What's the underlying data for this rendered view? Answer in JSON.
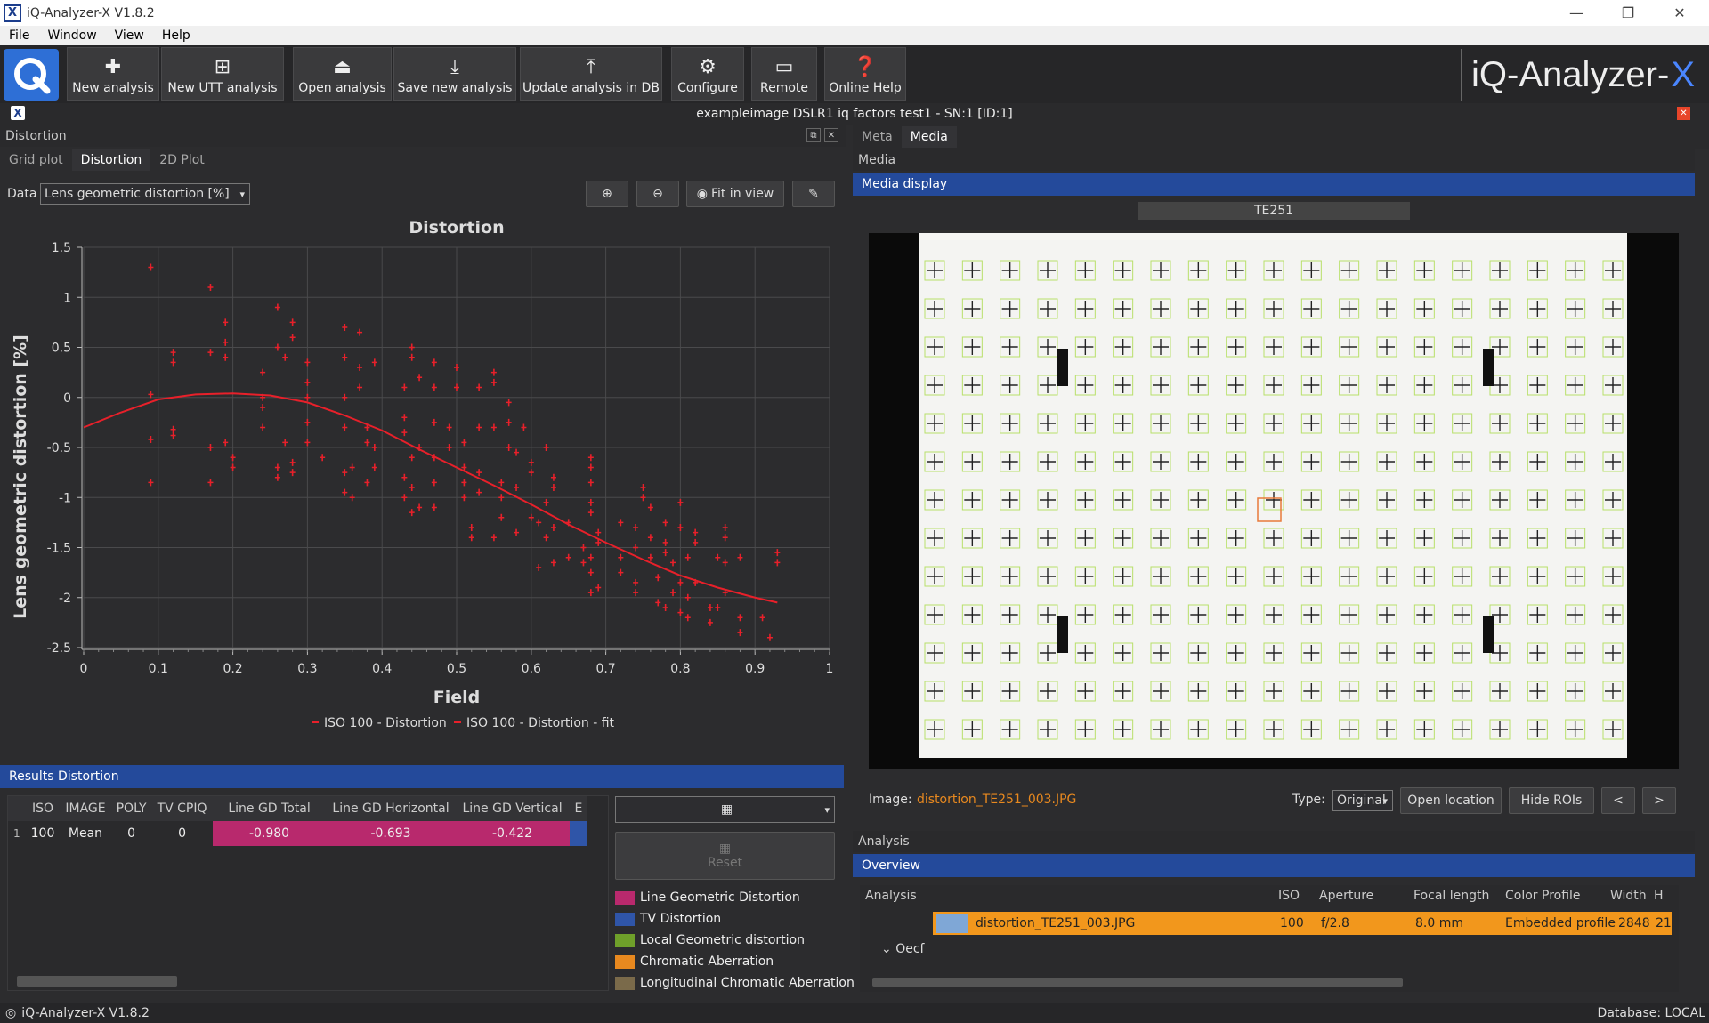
{
  "window": {
    "title": "iQ-Analyzer-X V1.8.2",
    "minimize_glyph": "—",
    "restore_glyph": "❐",
    "close_glyph": "✕"
  },
  "menu": [
    "File",
    "Window",
    "View",
    "Help"
  ],
  "toolbar": {
    "buttons": [
      {
        "label": "New analysis",
        "icon": "plus-icon"
      },
      {
        "label": "New UTT analysis",
        "icon": "utt-icon"
      },
      {
        "label": "Open analysis",
        "icon": "open-icon"
      },
      {
        "label": "Save new analysis",
        "icon": "save-icon"
      },
      {
        "label": "Update analysis in DB",
        "icon": "db-icon"
      },
      {
        "label": "Configure",
        "icon": "gear-icon"
      },
      {
        "label": "Remote",
        "icon": "monitor-icon"
      },
      {
        "label": "Online Help",
        "icon": "help-icon"
      }
    ],
    "brand": "iQ-Analyzer-",
    "brand_accent": "X"
  },
  "document": {
    "title": "exampleimage DSLR1 iq factors test1 - SN:1 [ID:1]"
  },
  "left_panel": {
    "title": "Distortion",
    "tabs": [
      "Grid plot",
      "Distortion",
      "2D Plot"
    ],
    "active_tab": "Distortion",
    "data_label": "Data",
    "data_select": "Lens geometric distortion [%]",
    "fit_button": "Fit in view"
  },
  "chart_data": {
    "type": "scatter",
    "title": "Distortion",
    "xlabel": "Field",
    "ylabel": "Lens geometric distortion [%]",
    "xlim": [
      0,
      1
    ],
    "ylim": [
      -2.5,
      1.5
    ],
    "xticks": [
      "0",
      "0.1",
      "0.2",
      "0.3",
      "0.4",
      "0.5",
      "0.6",
      "0.7",
      "0.8",
      "0.9",
      "1"
    ],
    "yticks": [
      "1.5",
      "1",
      "0.5",
      "0",
      "-0.5",
      "-1",
      "-1.5",
      "-2",
      "-2.5"
    ],
    "grid": true,
    "legend_placement": "bottom",
    "color": "#e8202a",
    "series": [
      {
        "name": "ISO 100 - Distortion",
        "kind": "scatter",
        "points": [
          [
            0.09,
            1.3
          ],
          [
            0.09,
            0.03
          ],
          [
            0.09,
            -0.42
          ],
          [
            0.09,
            -0.85
          ],
          [
            0.12,
            0.45
          ],
          [
            0.12,
            0.35
          ],
          [
            0.12,
            -0.38
          ],
          [
            0.12,
            -0.32
          ],
          [
            0.17,
            1.1
          ],
          [
            0.17,
            0.45
          ],
          [
            0.17,
            -0.5
          ],
          [
            0.17,
            -0.85
          ],
          [
            0.19,
            0.75
          ],
          [
            0.19,
            0.55
          ],
          [
            0.19,
            0.4
          ],
          [
            0.19,
            -0.45
          ],
          [
            0.2,
            -0.6
          ],
          [
            0.2,
            -0.7
          ],
          [
            0.24,
            0.25
          ],
          [
            0.24,
            0.0
          ],
          [
            0.24,
            -0.1
          ],
          [
            0.24,
            -0.3
          ],
          [
            0.26,
            0.9
          ],
          [
            0.26,
            0.5
          ],
          [
            0.26,
            -0.7
          ],
          [
            0.26,
            -0.8
          ],
          [
            0.27,
            0.4
          ],
          [
            0.27,
            -0.45
          ],
          [
            0.28,
            0.75
          ],
          [
            0.28,
            0.6
          ],
          [
            0.28,
            -0.65
          ],
          [
            0.28,
            -0.75
          ],
          [
            0.3,
            0.35
          ],
          [
            0.3,
            0.15
          ],
          [
            0.3,
            0.0
          ],
          [
            0.3,
            -0.25
          ],
          [
            0.3,
            -0.45
          ],
          [
            0.32,
            -0.6
          ],
          [
            0.35,
            0.7
          ],
          [
            0.35,
            0.4
          ],
          [
            0.35,
            0.0
          ],
          [
            0.35,
            -0.3
          ],
          [
            0.35,
            -0.75
          ],
          [
            0.35,
            -0.95
          ],
          [
            0.36,
            -0.7
          ],
          [
            0.36,
            -1.0
          ],
          [
            0.37,
            0.65
          ],
          [
            0.37,
            0.3
          ],
          [
            0.37,
            0.1
          ],
          [
            0.38,
            -0.3
          ],
          [
            0.38,
            -0.45
          ],
          [
            0.38,
            -0.85
          ],
          [
            0.39,
            0.35
          ],
          [
            0.39,
            -0.5
          ],
          [
            0.39,
            -0.7
          ],
          [
            0.43,
            0.1
          ],
          [
            0.43,
            -0.2
          ],
          [
            0.43,
            -0.35
          ],
          [
            0.43,
            -0.8
          ],
          [
            0.43,
            -1.0
          ],
          [
            0.44,
            0.5
          ],
          [
            0.44,
            0.4
          ],
          [
            0.44,
            -0.6
          ],
          [
            0.44,
            -0.9
          ],
          [
            0.44,
            -1.15
          ],
          [
            0.45,
            0.2
          ],
          [
            0.45,
            -0.5
          ],
          [
            0.45,
            -1.1
          ],
          [
            0.47,
            0.35
          ],
          [
            0.47,
            0.1
          ],
          [
            0.47,
            -0.25
          ],
          [
            0.47,
            -0.6
          ],
          [
            0.47,
            -0.85
          ],
          [
            0.47,
            -1.1
          ],
          [
            0.49,
            -0.3
          ],
          [
            0.49,
            -0.5
          ],
          [
            0.5,
            0.3
          ],
          [
            0.5,
            0.1
          ],
          [
            0.51,
            -0.45
          ],
          [
            0.51,
            -0.7
          ],
          [
            0.51,
            -0.85
          ],
          [
            0.51,
            -1.0
          ],
          [
            0.52,
            -1.4
          ],
          [
            0.52,
            -1.3
          ],
          [
            0.53,
            0.1
          ],
          [
            0.53,
            -0.3
          ],
          [
            0.53,
            -0.75
          ],
          [
            0.53,
            -0.95
          ],
          [
            0.55,
            0.25
          ],
          [
            0.55,
            0.15
          ],
          [
            0.55,
            -0.3
          ],
          [
            0.55,
            -1.4
          ],
          [
            0.56,
            -0.85
          ],
          [
            0.56,
            -1.0
          ],
          [
            0.56,
            -1.2
          ],
          [
            0.57,
            -0.05
          ],
          [
            0.57,
            -0.25
          ],
          [
            0.57,
            -0.5
          ],
          [
            0.58,
            -0.55
          ],
          [
            0.58,
            -0.9
          ],
          [
            0.58,
            -1.35
          ],
          [
            0.59,
            -0.3
          ],
          [
            0.6,
            -0.65
          ],
          [
            0.6,
            -0.75
          ],
          [
            0.6,
            -1.2
          ],
          [
            0.61,
            -1.25
          ],
          [
            0.61,
            -1.7
          ],
          [
            0.62,
            -0.5
          ],
          [
            0.62,
            -1.05
          ],
          [
            0.62,
            -1.4
          ],
          [
            0.63,
            -0.8
          ],
          [
            0.63,
            -0.9
          ],
          [
            0.63,
            -1.3
          ],
          [
            0.63,
            -1.65
          ],
          [
            0.65,
            -1.25
          ],
          [
            0.65,
            -1.6
          ],
          [
            0.67,
            -1.5
          ],
          [
            0.67,
            -1.65
          ],
          [
            0.68,
            -0.6
          ],
          [
            0.68,
            -0.7
          ],
          [
            0.68,
            -0.85
          ],
          [
            0.68,
            -1.05
          ],
          [
            0.68,
            -1.15
          ],
          [
            0.68,
            -1.6
          ],
          [
            0.68,
            -1.75
          ],
          [
            0.68,
            -1.95
          ],
          [
            0.69,
            -1.35
          ],
          [
            0.69,
            -1.45
          ],
          [
            0.69,
            -1.9
          ],
          [
            0.72,
            -1.25
          ],
          [
            0.72,
            -1.6
          ],
          [
            0.72,
            -1.75
          ],
          [
            0.74,
            -1.3
          ],
          [
            0.74,
            -1.5
          ],
          [
            0.74,
            -1.85
          ],
          [
            0.74,
            -1.95
          ],
          [
            0.75,
            -0.9
          ],
          [
            0.75,
            -1.0
          ],
          [
            0.76,
            -1.1
          ],
          [
            0.76,
            -1.4
          ],
          [
            0.76,
            -1.6
          ],
          [
            0.77,
            -1.8
          ],
          [
            0.77,
            -2.05
          ],
          [
            0.78,
            -1.25
          ],
          [
            0.78,
            -1.45
          ],
          [
            0.78,
            -1.55
          ],
          [
            0.78,
            -2.1
          ],
          [
            0.79,
            -1.65
          ],
          [
            0.79,
            -1.95
          ],
          [
            0.8,
            -1.05
          ],
          [
            0.8,
            -1.3
          ],
          [
            0.8,
            -1.85
          ],
          [
            0.8,
            -2.15
          ],
          [
            0.81,
            -2.0
          ],
          [
            0.81,
            -2.2
          ],
          [
            0.81,
            -1.6
          ],
          [
            0.82,
            -1.35
          ],
          [
            0.82,
            -1.45
          ],
          [
            0.82,
            -1.85
          ],
          [
            0.84,
            -2.1
          ],
          [
            0.84,
            -2.25
          ],
          [
            0.85,
            -1.6
          ],
          [
            0.85,
            -2.1
          ],
          [
            0.86,
            -1.3
          ],
          [
            0.86,
            -1.4
          ],
          [
            0.86,
            -1.65
          ],
          [
            0.86,
            -1.95
          ],
          [
            0.88,
            -2.2
          ],
          [
            0.88,
            -2.35
          ],
          [
            0.88,
            -1.6
          ],
          [
            0.91,
            -2.2
          ],
          [
            0.92,
            -2.4
          ],
          [
            0.93,
            -1.55
          ],
          [
            0.93,
            -1.65
          ]
        ]
      },
      {
        "name": "ISO 100 - Distortion - fit",
        "kind": "line",
        "points": [
          [
            0.0,
            -0.3
          ],
          [
            0.05,
            -0.15
          ],
          [
            0.1,
            -0.02
          ],
          [
            0.15,
            0.03
          ],
          [
            0.2,
            0.04
          ],
          [
            0.25,
            0.02
          ],
          [
            0.3,
            -0.05
          ],
          [
            0.35,
            -0.18
          ],
          [
            0.4,
            -0.33
          ],
          [
            0.45,
            -0.52
          ],
          [
            0.5,
            -0.7
          ],
          [
            0.55,
            -0.88
          ],
          [
            0.6,
            -1.07
          ],
          [
            0.65,
            -1.27
          ],
          [
            0.7,
            -1.45
          ],
          [
            0.75,
            -1.62
          ],
          [
            0.8,
            -1.78
          ],
          [
            0.85,
            -1.9
          ],
          [
            0.9,
            -2.0
          ],
          [
            0.93,
            -2.05
          ]
        ]
      }
    ]
  },
  "results": {
    "title": "Results Distortion",
    "columns": [
      "ISO",
      "IMAGE",
      "POLY",
      "TV CPIQ",
      "Line GD Total",
      "Line GD Horizontal",
      "Line GD Vertical",
      "E"
    ],
    "rows": [
      {
        "index": "1",
        "cells": [
          "100",
          "Mean",
          "0",
          "0",
          "-0.980",
          "-0.693",
          "-0.422",
          ""
        ]
      }
    ],
    "reset_label": "Reset",
    "table_icon": "table-icon",
    "legend": [
      {
        "label": "Line Geometric Distortion",
        "color": "#b8296d"
      },
      {
        "label": "TV Distortion",
        "color": "#2f55a8"
      },
      {
        "label": "Local Geometric distortion",
        "color": "#6fa02a"
      },
      {
        "label": "Chromatic Aberration",
        "color": "#e8891f"
      },
      {
        "label": "Longitudinal Chromatic Aberration",
        "color": "#7a6a4a"
      }
    ]
  },
  "right_panel": {
    "tabs": [
      "Meta",
      "Media"
    ],
    "active_tab": "Media",
    "media_title": "Media",
    "media_display": "Media display",
    "chart_label": "TE251",
    "image_label": "Image:",
    "image_file": "distortion_TE251_003.JPG",
    "type_label": "Type:",
    "type_value": "Original",
    "open_location": "Open location",
    "hide_rois": "Hide ROIs",
    "prev": "<",
    "next": ">"
  },
  "analysis": {
    "title": "Analysis",
    "overview": "Overview",
    "columns": [
      "Analysis",
      "ISO",
      "Aperture",
      "Focal length",
      "Color Profile",
      "Width",
      "H"
    ],
    "row": {
      "analysis": "distortion_TE251_003.JPG",
      "iso": "100",
      "aperture": "f/2.8",
      "focal": "8.0 mm",
      "profile": "Embedded profile",
      "width": "2848",
      "h": "21"
    },
    "group": "Oecf"
  },
  "status": {
    "left": "iQ-Analyzer-X V1.8.2",
    "right": "Database: LOCAL"
  }
}
